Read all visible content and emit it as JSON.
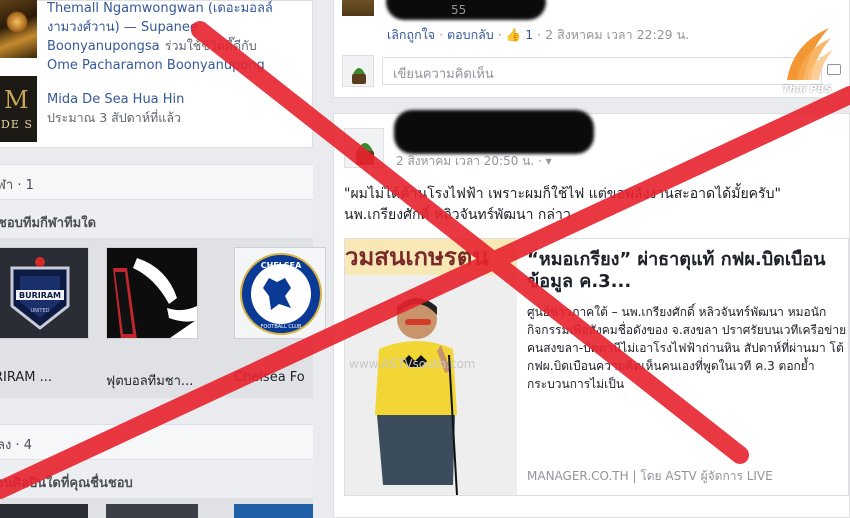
{
  "left": {
    "suggestions": [
      {
        "title": "Themall Ngamwongwan (เดอะมอลล์งามวงศ์วาน)",
        "line2_prefix": " — Supanee Boonyanupongsa",
        "line2_suffix": "ร่วมใช้ชีวิตดี๊ดีกับ",
        "line3": "Ome Pacharamon Boonyanupong"
      },
      {
        "title": "Mida De Sea Hua Hin",
        "subtitle": "ประมาณ 3 สัปดาห์ที่แล้ว",
        "logo_mono": "M",
        "logo_word": "DE S"
      }
    ],
    "section1_header": "ฬา · 1",
    "section1_sub": "ชอบทีมกีฬาทีมใด",
    "teams": [
      {
        "label": "RIRAM ...",
        "icon": "buriram-united-badge"
      },
      {
        "label": "ฟุตบอลทีมชา...",
        "icon": "football-jersey"
      },
      {
        "label": "Chelsea Fo",
        "icon": "chelsea-fc-crest"
      }
    ],
    "section2_header": "ลง · 4",
    "section2_sub": "อนศิลปินใดที่คุณชื่นชอบ"
  },
  "right": {
    "comment1": {
      "like": "เลิกถูกใจ",
      "reply": "ตอบกลับ",
      "like_count": "1",
      "timestamp": "2 สิงหาคม เวลา 22:29 น.",
      "redacted_suffix": "55"
    },
    "comment_placeholder": "เขียนความคิดเห็น",
    "post2": {
      "meta": "2 สิงหาคม เวลา 20:50 น. ·",
      "quote": "\"ผมไม่ได้ค้านโรงไฟฟ้า เพราะผมก็ใช้ไฟ แต่ขอพลังงานสะอาดได้มั้ยครับ\"",
      "byline": "นพ.เกรียงศักดิ์ หลิวจันทร์พัฒนา กล่าว",
      "link": {
        "image_banner": "วมสนเกษรตน",
        "image_watermark": "www.ASTVsouth.com",
        "title": "“หมอเกรียง” ผ่าธาตุแท้ กฟผ.บิดเบือนข้อมูล ค.3...",
        "description": "ศูนย์ข่าวภาคใต้ – นพ.เกรียงศักดิ์ หลิวจันทร์พัฒนา หมอนักกิจกรรมเพื่อสังคมชื่อดังของ จ.สงขลา ปราศรัยบนเวทีเครือข่ายคนสงขลา-ปัตตานีไม่เอาโรงไฟฟ้าถ่านหิน สัปดาห์ที่ผ่านมา โต้ กฟผ.บิดเบือนความคิดเห็นคนเองที่พูดในเวที ค.3 ตอกย้ำกระบวนการไม่เป็น",
        "source": "MANAGER.CO.TH | โดย ASTV ผู้จัดการ LIVE"
      }
    }
  },
  "watermark_logo": "Thai PBS",
  "colors": {
    "link_blue": "#365899",
    "cross_red": "#e8232f",
    "page_bg": "#e9ebee"
  }
}
